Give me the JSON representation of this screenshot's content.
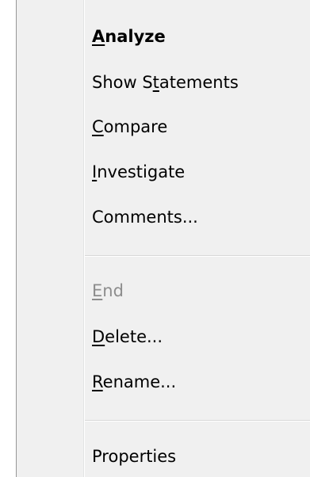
{
  "context_menu": {
    "items": [
      {
        "id": "analyze",
        "pre": "",
        "mn": "A",
        "post": "nalyze",
        "bold": true,
        "disabled": false
      },
      {
        "id": "show-statements",
        "pre": "Show S",
        "mn": "t",
        "post": "atements",
        "bold": false,
        "disabled": false
      },
      {
        "id": "compare",
        "pre": "",
        "mn": "C",
        "post": "ompare",
        "bold": false,
        "disabled": false
      },
      {
        "id": "investigate",
        "pre": "",
        "mn": "I",
        "post": "nvestigate",
        "bold": false,
        "disabled": false
      },
      {
        "id": "comments",
        "pre": "Comments...",
        "mn": "",
        "post": "",
        "bold": false,
        "disabled": false
      },
      {
        "id": "end",
        "pre": "",
        "mn": "E",
        "post": "nd",
        "bold": false,
        "disabled": true
      },
      {
        "id": "delete",
        "pre": "",
        "mn": "D",
        "post": "elete...",
        "bold": false,
        "disabled": false
      },
      {
        "id": "rename",
        "pre": "",
        "mn": "R",
        "post": "ename...",
        "bold": false,
        "disabled": false
      },
      {
        "id": "properties",
        "pre": "Properties",
        "mn": "",
        "post": "",
        "bold": false,
        "disabled": false
      }
    ]
  }
}
